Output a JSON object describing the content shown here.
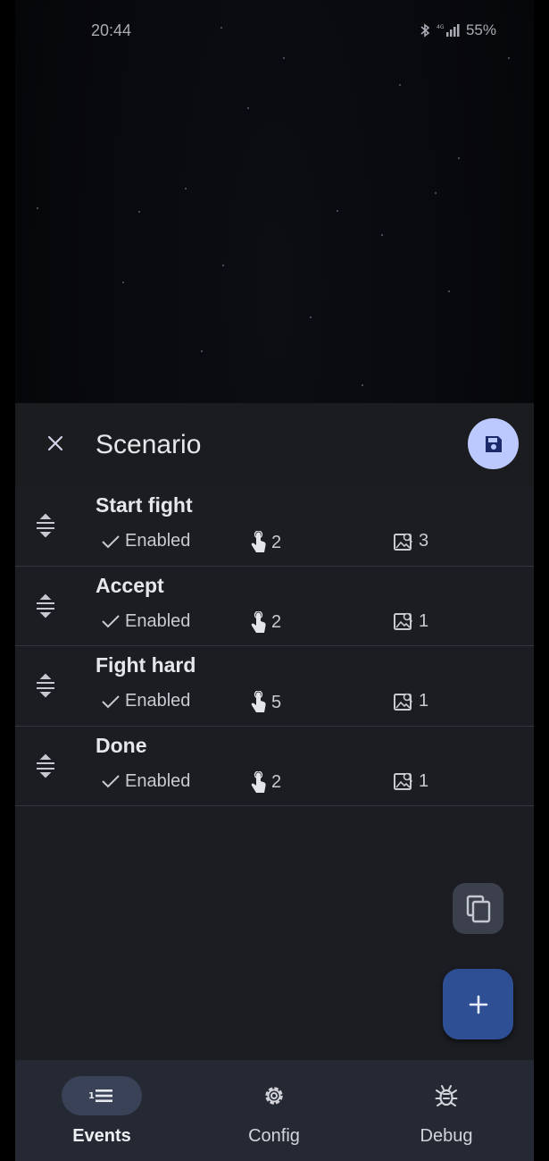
{
  "status_bar": {
    "time": "20:44",
    "battery": "55%"
  },
  "sheet": {
    "title": "Scenario",
    "close_icon": "close-icon",
    "save_icon": "save-icon"
  },
  "events": [
    {
      "name": "Start fight",
      "status": "Enabled",
      "clicks": "2",
      "images": "3"
    },
    {
      "name": "Accept",
      "status": "Enabled",
      "clicks": "2",
      "images": "1"
    },
    {
      "name": "Fight hard",
      "status": "Enabled",
      "clicks": "5",
      "images": "1"
    },
    {
      "name": "Done",
      "status": "Enabled",
      "clicks": "2",
      "images": "1"
    }
  ],
  "fab": {
    "copy_icon": "copy-icon",
    "add_icon": "add-icon"
  },
  "nav": [
    {
      "label": "Events",
      "icon": "events-list-icon",
      "active": true
    },
    {
      "label": "Config",
      "icon": "gear-icon",
      "active": false
    },
    {
      "label": "Debug",
      "icon": "bug-icon",
      "active": false
    }
  ],
  "colors": {
    "accent": "#bcc9ff",
    "fab": "#2f4f95",
    "sheet_bg": "#1b1d22",
    "nav_bg": "#252933"
  }
}
